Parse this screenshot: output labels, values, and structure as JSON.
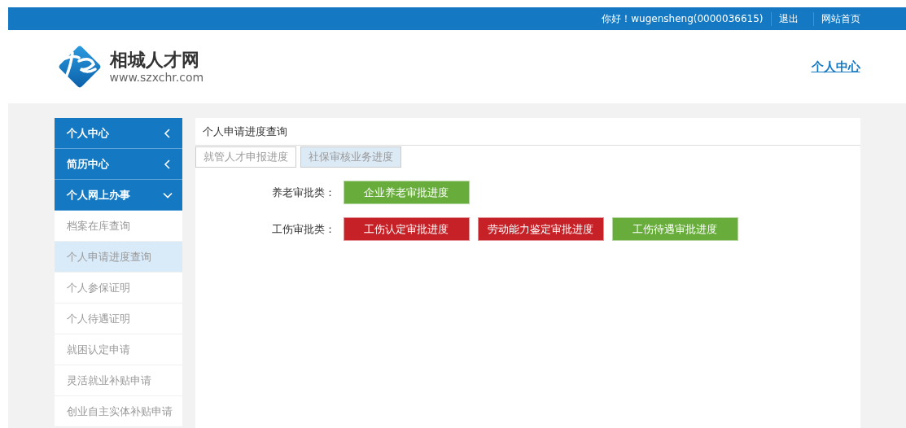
{
  "top_bar": {
    "greeting": "你好！wugensheng(0000036615)",
    "links": [
      "退出",
      "网站首页"
    ]
  },
  "header": {
    "site_name": "相城人才网",
    "site_url": "www.szxchr.com",
    "nav_link": "个人中心"
  },
  "sidebar": {
    "sections": [
      {
        "label": "个人中心",
        "expanded": false
      },
      {
        "label": "简历中心",
        "expanded": false
      },
      {
        "label": "个人网上办事",
        "expanded": true,
        "children": [
          {
            "label": "档案在库查询",
            "selected": false
          },
          {
            "label": "个人申请进度查询",
            "selected": true
          },
          {
            "label": "个人参保证明",
            "selected": false
          },
          {
            "label": "个人待遇证明",
            "selected": false
          },
          {
            "label": "就困认定申请",
            "selected": false
          },
          {
            "label": "灵活就业补贴申请",
            "selected": false
          },
          {
            "label": "创业自主实体补贴申请",
            "selected": false
          }
        ]
      }
    ]
  },
  "panel": {
    "title": "个人申请进度查询",
    "tabs": [
      {
        "label": "就管人才申报进度",
        "selected": false
      },
      {
        "label": "社保审核业务进度",
        "selected": true
      }
    ],
    "groups": [
      {
        "label": "养老审批类：",
        "buttons": [
          {
            "label": "企业养老审批进度",
            "color": "#68ad3c"
          }
        ]
      },
      {
        "label": "工伤审批类：",
        "buttons": [
          {
            "label": "工伤认定审批进度",
            "color": "#c52127"
          },
          {
            "label": "劳动能力鉴定审批进度",
            "color": "#c52127"
          },
          {
            "label": "工伤待遇审批进度",
            "color": "#68ad3c"
          }
        ]
      }
    ]
  }
}
